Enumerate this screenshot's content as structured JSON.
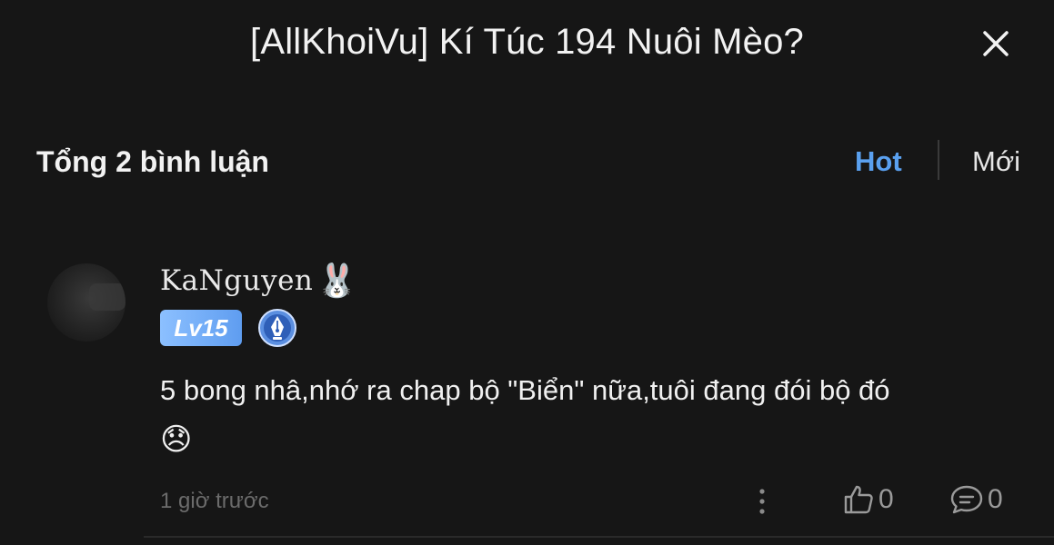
{
  "header": {
    "title": "[AllKhoiVu] Kí Túc 194 Nuôi Mèo?",
    "close_icon": "close-icon"
  },
  "toolbar": {
    "total_label": "Tổng 2 bình luận",
    "sort_hot": "Hot",
    "sort_new": "Mới",
    "active_sort": "Hot",
    "accent_color": "#5aa0ef"
  },
  "comment": {
    "username": "KaNguyen",
    "username_emoji": "🐰",
    "level": "Lv15",
    "text": "5 bong nhâ,nhớ ra chap bộ \"Biển\" nữa,tuôi đang đói bộ đó",
    "text_emoji": "😞",
    "time": "1 giờ trước",
    "likes": "0",
    "replies": "0"
  }
}
